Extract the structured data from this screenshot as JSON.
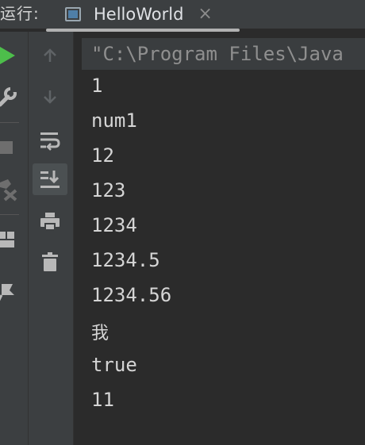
{
  "titlebar": {
    "run_label": "运行:",
    "tab_title": "HelloWorld",
    "close_glyph": "×"
  },
  "console": {
    "command_text": "\"C:\\Program Files\\Java",
    "lines": [
      "1",
      "num1",
      "12",
      "123",
      "1234",
      "1234.5",
      "1234.56",
      "我",
      "true",
      "11"
    ]
  },
  "icons": {
    "left": [
      "run-icon",
      "wrench-icon",
      "stop-icon",
      "cancel-icon",
      "layout-icon",
      "pin-icon"
    ],
    "side": [
      "arrow-up-icon",
      "arrow-down-icon",
      "soft-wrap-icon",
      "scroll-to-end-icon",
      "print-icon",
      "trash-icon"
    ]
  },
  "colors": {
    "run_green": "#4dbe4b",
    "background": "#2b2b2b",
    "panel": "#3c3f41",
    "text": "#d5d5d5"
  }
}
